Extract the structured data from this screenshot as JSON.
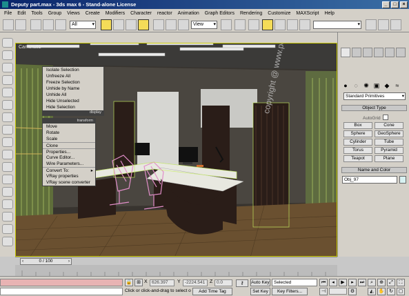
{
  "window": {
    "title": "Deputy part.max - 3ds max 6 - Stand-alone License"
  },
  "menu": [
    "File",
    "Edit",
    "Tools",
    "Group",
    "Views",
    "Create",
    "Modifiers",
    "Character",
    "reactor",
    "Animation",
    "Graph Editors",
    "Rendering",
    "Customize",
    "MAXScript",
    "Help"
  ],
  "toolbar": {
    "selection_filter": "All",
    "reference_coord": "View"
  },
  "viewport": {
    "label": "Camera02",
    "watermark": "copyright @ www.pezhman.net"
  },
  "quad_menu": {
    "display_items": [
      "Isolate Selection",
      "Unfreeze All",
      "Freeze Selection",
      "Unhide by Name",
      "Unhide All",
      "Hide Unselected",
      "Hide Selection"
    ],
    "display_header": "display",
    "transform_header": "transform",
    "transform_items": [
      "Move",
      "Rotate",
      "Scale",
      "Clone",
      "Properties...",
      "Curve Editor...",
      "Wire Parameters...",
      "Convert To:",
      "VRay properties",
      "VRay scene converter"
    ]
  },
  "command_panel": {
    "dropdown": "Standard Primitives",
    "object_type_title": "Object Type",
    "autogrid_label": "AutoGrid",
    "primitives": [
      "Box",
      "Cone",
      "Sphere",
      "GeoSphere",
      "Cylinder",
      "Tube",
      "Torus",
      "Pyramid",
      "Teapot",
      "Plane"
    ],
    "name_color_title": "Name and Color",
    "object_name": "Obj_97",
    "object_color": "#d8f2f2"
  },
  "time_slider": {
    "label": "0 / 100"
  },
  "status": {
    "x_label": "X",
    "x": "626.397",
    "y_label": "Y",
    "y": "-2224.541",
    "z_label": "Z",
    "z": "0.0",
    "auto_key": "Auto Key",
    "selected": "Selected",
    "set_key": "Set Key",
    "key_filters": "Key Filters...",
    "prompt": "Click or click-and-drag to select ob",
    "add_time_tag": "Add Time Tag"
  }
}
